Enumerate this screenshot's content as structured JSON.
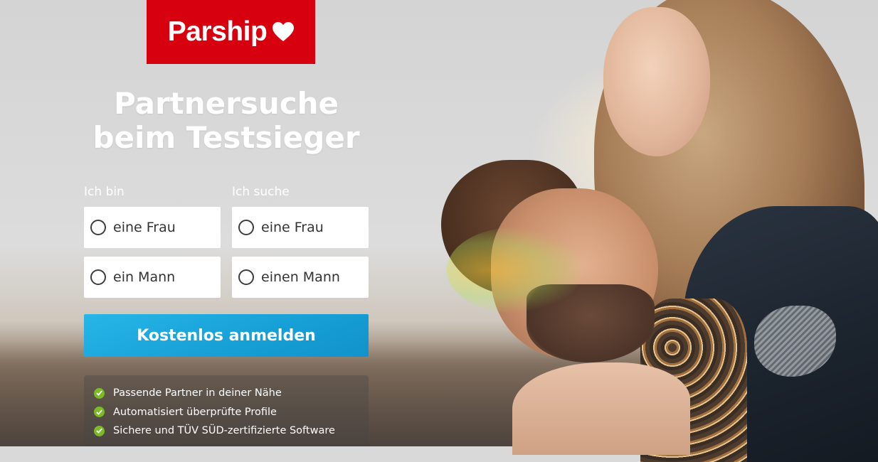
{
  "brand": {
    "name": "Parship",
    "color": "#d6000f"
  },
  "headline": {
    "line1": "Partnersuche",
    "line2": "beim Testsieger"
  },
  "form": {
    "i_am": {
      "label": "Ich bin",
      "options": [
        "eine Frau",
        "ein Mann"
      ]
    },
    "seeking": {
      "label": "Ich suche",
      "options": [
        "eine Frau",
        "einen Mann"
      ]
    },
    "submit_label": "Kostenlos anmelden",
    "submit_color": "#1aa7df"
  },
  "benefits": [
    "Passende Partner in deiner Nähe",
    "Automatisiert überprüfte Profile",
    "Sichere und TÜV SÜD-zertifizierte Software"
  ],
  "icons": {
    "logo_heart": "heart-icon",
    "radio": "radio-unchecked-icon",
    "check": "checkmark-icon"
  },
  "colors": {
    "check_green": "#7cba27"
  }
}
